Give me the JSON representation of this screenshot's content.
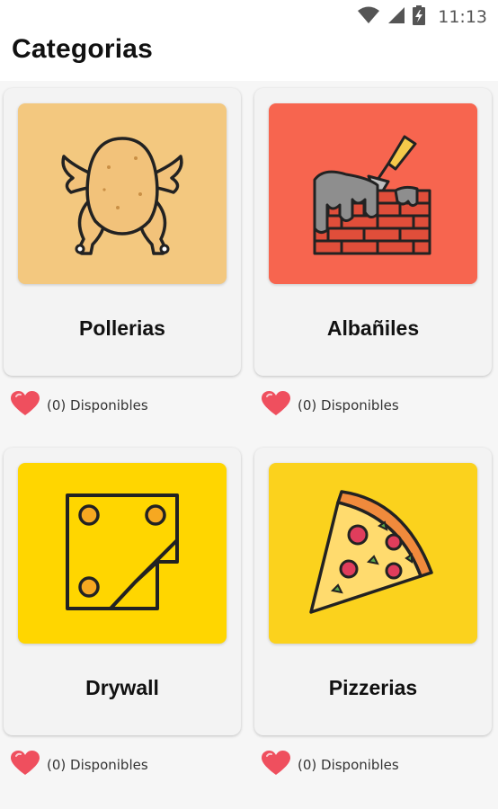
{
  "status_bar": {
    "time": "11:13",
    "icons": [
      "wifi-icon",
      "signal-icon",
      "battery-charging-icon"
    ]
  },
  "header": {
    "title": "Categorias"
  },
  "categories": [
    {
      "label": "Pollerias",
      "availability": "(0) Disponibles",
      "icon": "roast-chicken-icon",
      "bg_color": "#f3c87f"
    },
    {
      "label": "Albañiles",
      "availability": "(0) Disponibles",
      "icon": "brick-wall-trowel-icon",
      "bg_color": "#f7654f"
    },
    {
      "label": "Drywall",
      "availability": "(0) Disponibles",
      "icon": "drywall-panel-icon",
      "bg_color": "#ffd600"
    },
    {
      "label": "Pizzerias",
      "availability": "(0) Disponibles",
      "icon": "pizza-slice-icon",
      "bg_color": "#fbd21d"
    }
  ],
  "colors": {
    "heart": "#ef4f5e",
    "card_bg": "#f3f3f3",
    "page_bg": "#f6f6f6"
  }
}
